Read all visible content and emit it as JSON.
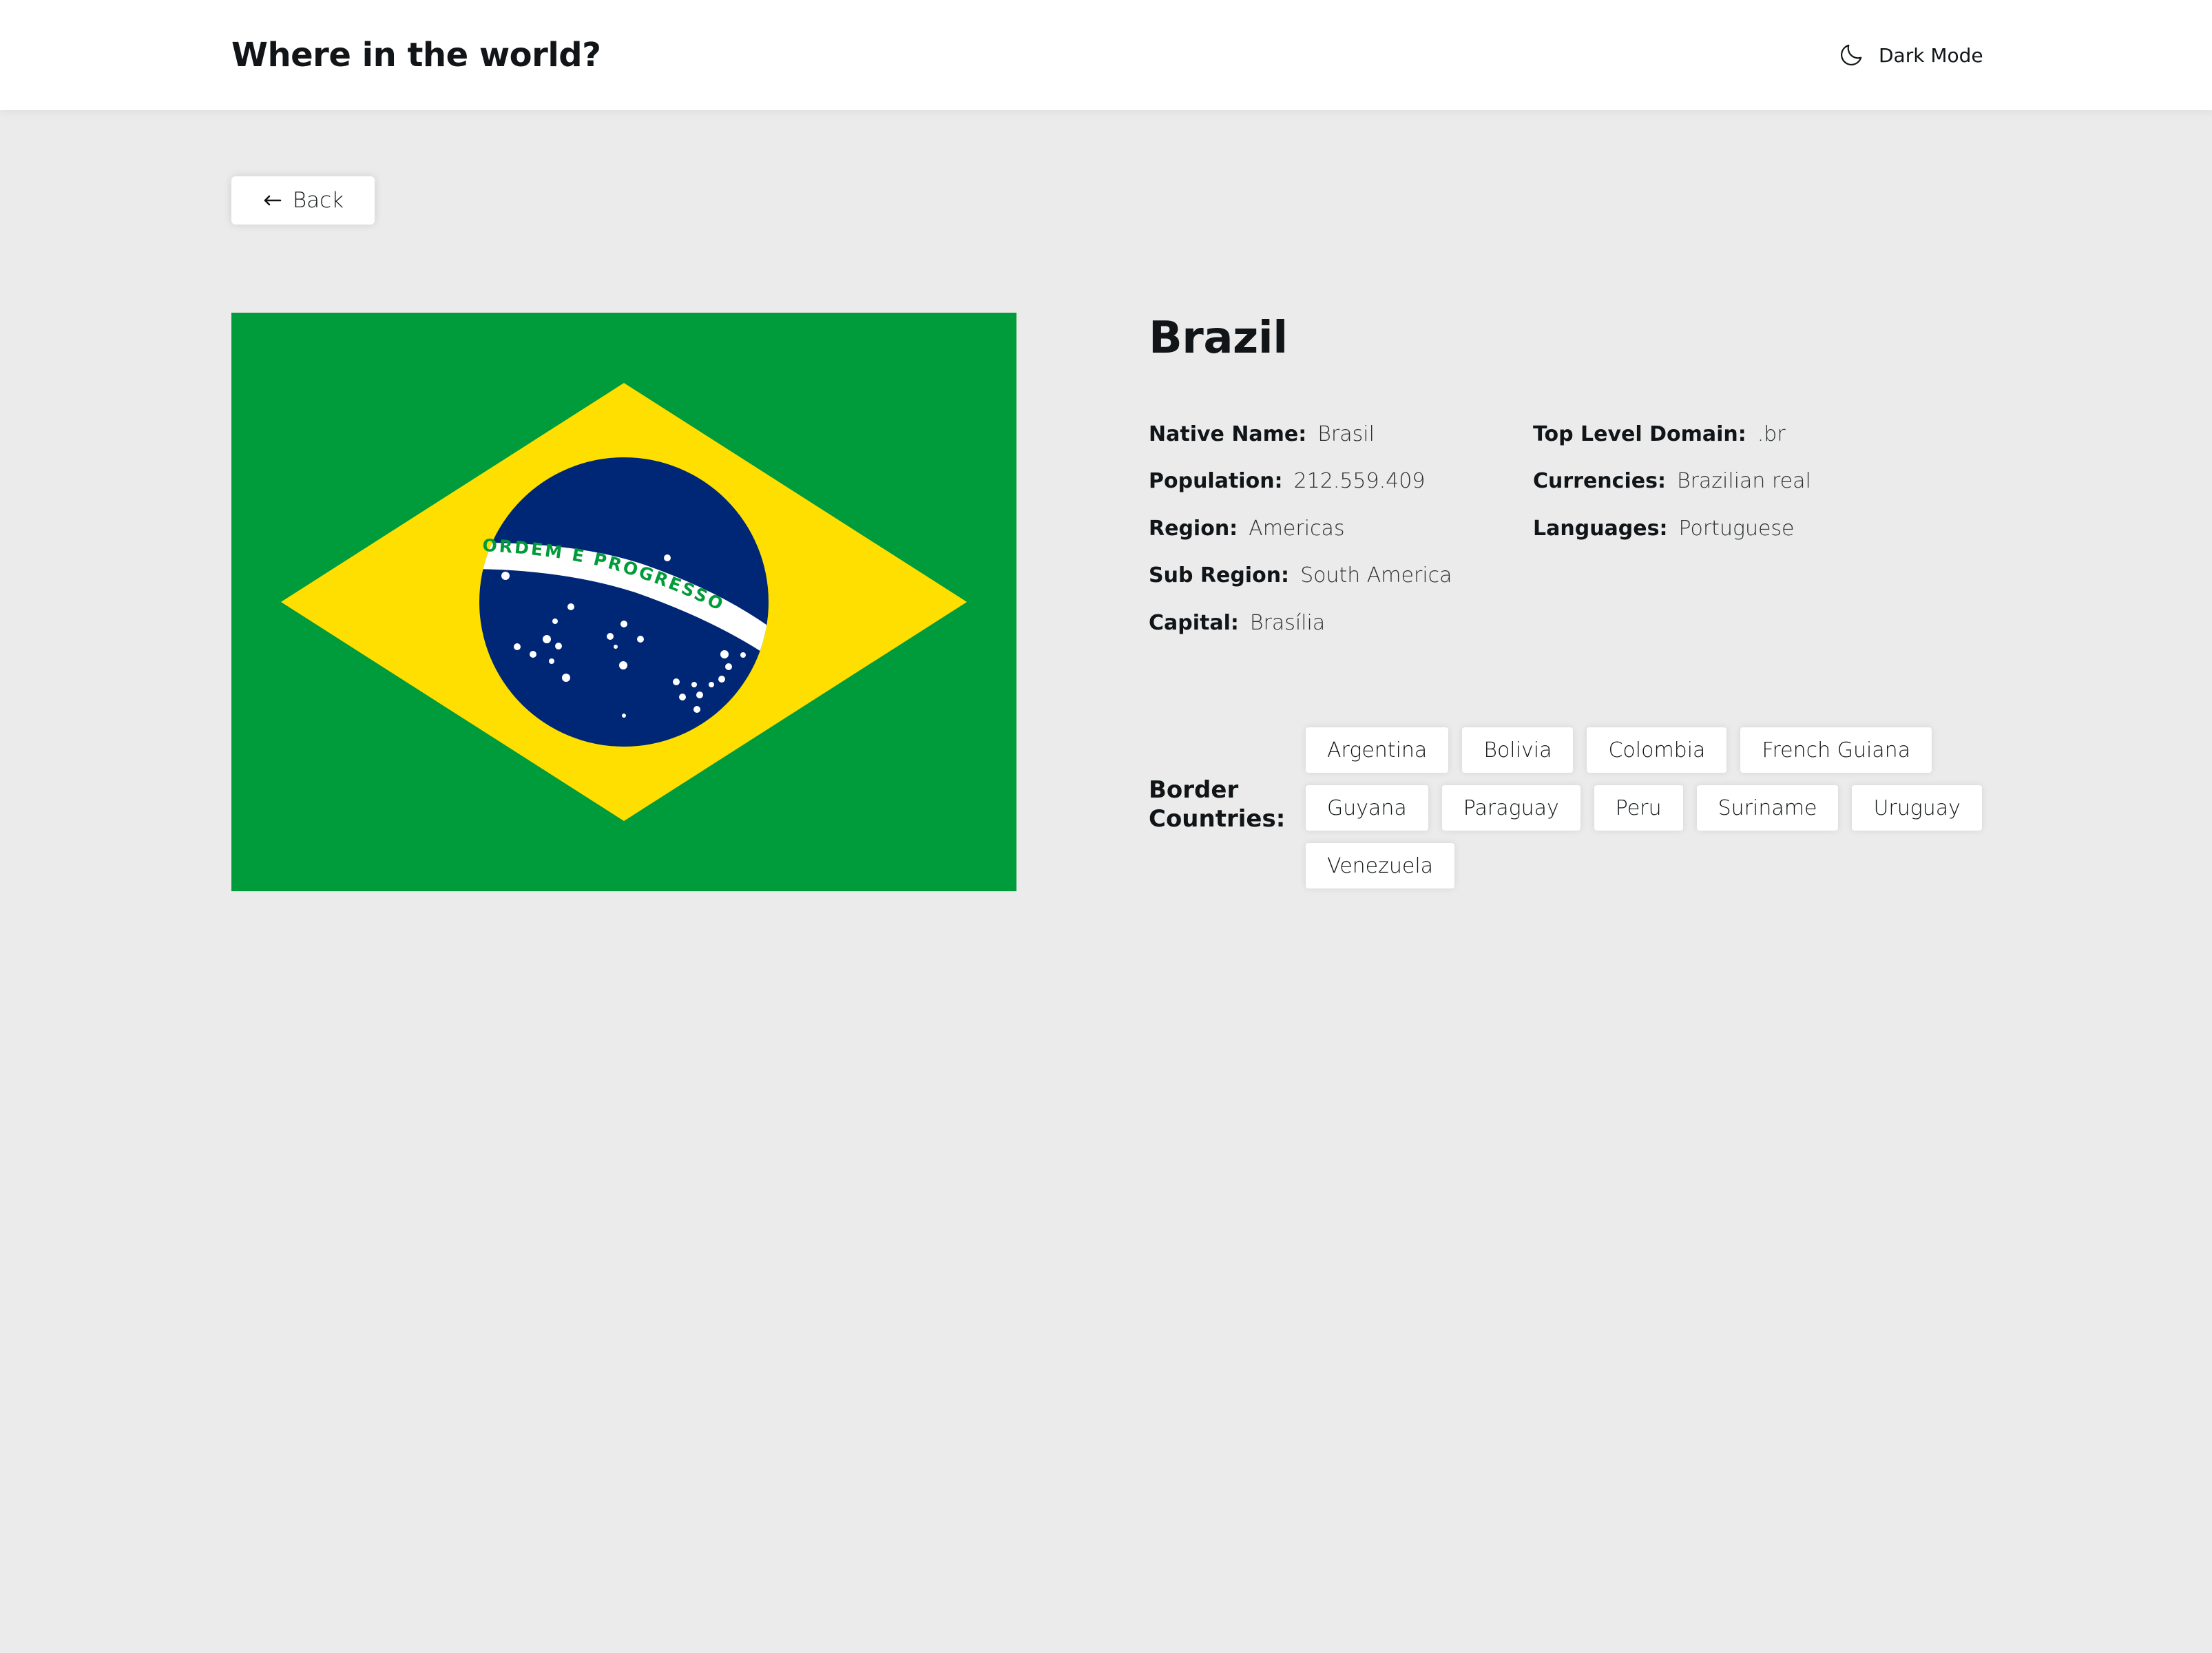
{
  "header": {
    "title": "Where in the world?",
    "dark_mode_label": "Dark Mode",
    "dark_mode_icon": "moon-icon"
  },
  "back_button": {
    "label": "Back",
    "icon": "arrow-left-icon"
  },
  "flag": {
    "motto": "ORDEM E PROGRESSO",
    "colors": {
      "green": "#009b3a",
      "yellow": "#fedf00",
      "blue": "#002776",
      "white": "#ffffff"
    }
  },
  "country": {
    "name": "Brazil",
    "details_left": [
      {
        "label": "Native Name:",
        "value": "Brasil"
      },
      {
        "label": "Population:",
        "value": "212.559.409"
      },
      {
        "label": "Region:",
        "value": "Americas"
      },
      {
        "label": "Sub Region:",
        "value": "South America"
      },
      {
        "label": "Capital:",
        "value": "Brasília"
      }
    ],
    "details_right": [
      {
        "label": "Top Level Domain:",
        "value": ".br"
      },
      {
        "label": "Currencies:",
        "value": "Brazilian real"
      },
      {
        "label": "Languages:",
        "value": "Portuguese"
      }
    ],
    "border_label": "Border Countries:",
    "borders": [
      "Argentina",
      "Bolivia",
      "Colombia",
      "French Guiana",
      "Guyana",
      "Paraguay",
      "Peru",
      "Suriname",
      "Uruguay",
      "Venezuela"
    ]
  },
  "colors": {
    "header_bg": "#ffffff",
    "page_bg": "#ebebeb",
    "text": "#111517"
  }
}
